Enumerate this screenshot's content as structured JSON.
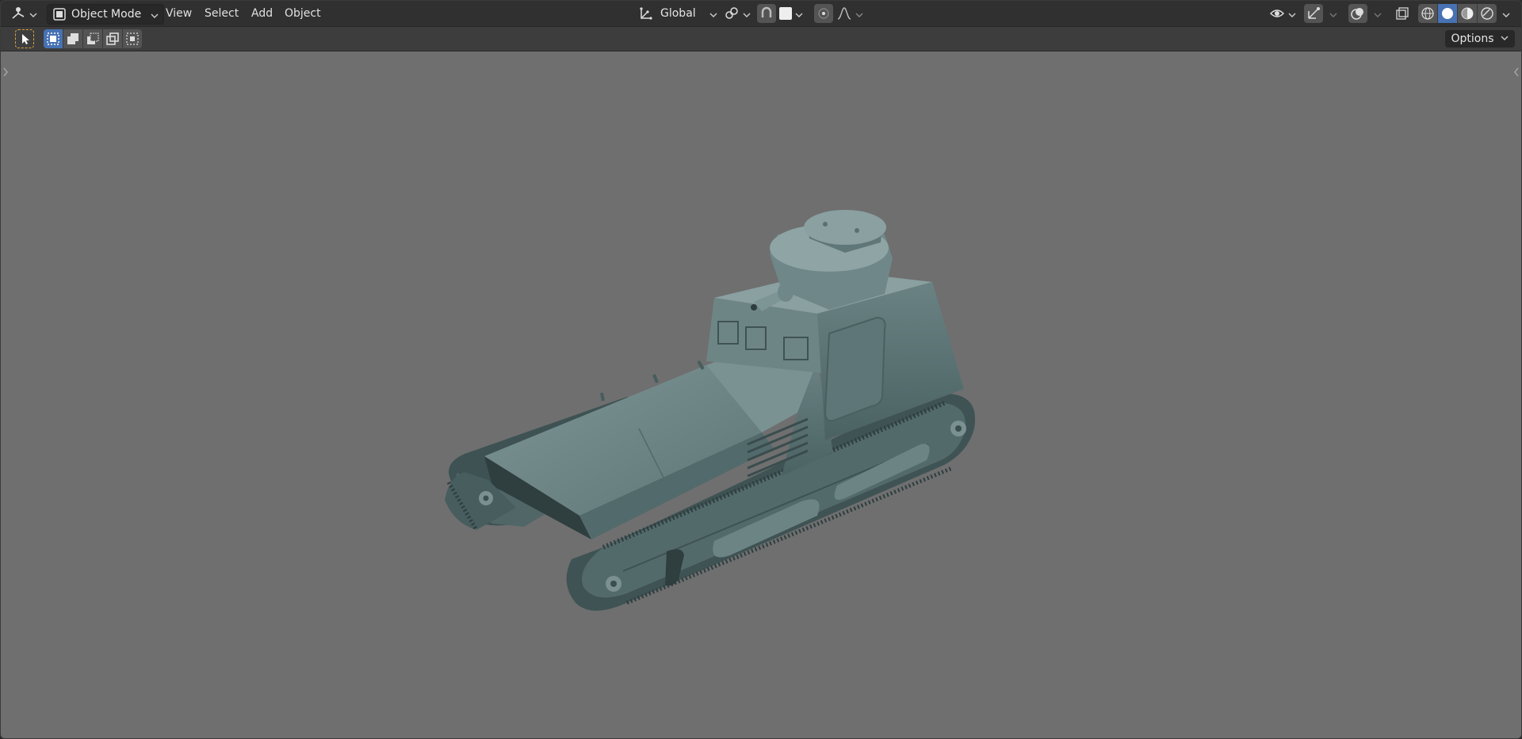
{
  "header": {
    "editor_type_icon": "view3d-gizmo-icon",
    "mode": {
      "label": "Object Mode",
      "icon": "object-mode-icon"
    },
    "menus": [
      "View",
      "Select",
      "Add",
      "Object"
    ],
    "transform_orientation": {
      "label": "Global",
      "icon": "orientation-axes-icon"
    },
    "snapping_icon": "snap-icon",
    "proportional_icon": "proportional-edit-icon",
    "falloff_icon": "falloff-curve-icon",
    "visibility_icon": "eye-visibility-icon",
    "gizmo_icon": "gizmo-icon",
    "overlay_icon": "overlay-icon",
    "xray_icon": "xray-icon",
    "shading_icons": [
      "wireframe-shading-icon",
      "solid-shading-icon",
      "material-shading-icon",
      "rendered-shading-icon"
    ],
    "active_shading": "solid-shading-icon"
  },
  "toolbar": {
    "select_tool_icon": "select-box-tool-icon",
    "selection_modes": [
      "set-new-selection-icon",
      "extend-selection-icon",
      "subtract-selection-icon",
      "invert-selection-icon",
      "intersect-selection-icon"
    ],
    "active_selection_mode": "set-new-selection-icon",
    "options_label": "Options"
  },
  "colors": {
    "header_bg": "#303030",
    "toolbar_bg": "#3d3d3d",
    "viewport_bg": "#6f6f6f",
    "accent": "#4772b3",
    "model_base": "#5e7677"
  }
}
